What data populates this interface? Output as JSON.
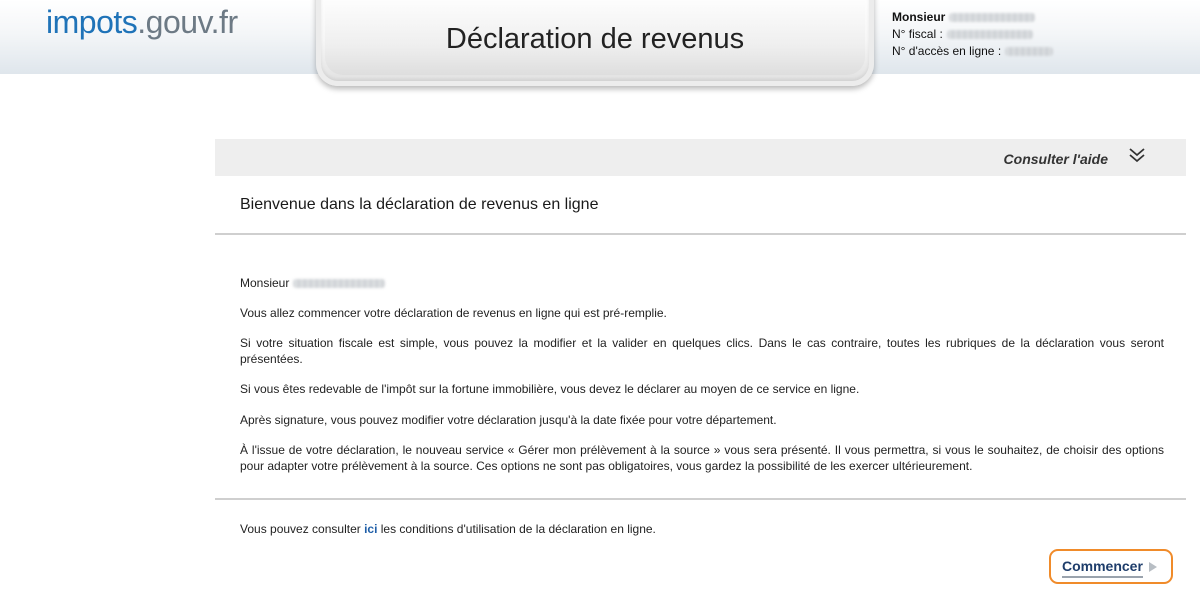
{
  "header": {
    "logo_part1": "impots",
    "logo_part2": ".gouv.fr",
    "page_title": "Déclaration de revenus",
    "user": {
      "salutation": "Monsieur",
      "fiscal_label": "N° fiscal :",
      "access_label": "N° d'accès en ligne :"
    }
  },
  "help": {
    "label": "Consulter l'aide",
    "icon": "double-chevron-down-icon"
  },
  "main": {
    "welcome": "Bienvenue dans la déclaration de revenus en ligne",
    "greeting": "Monsieur",
    "paragraphs": [
      "Vous allez commencer votre déclaration de revenus en ligne qui est pré-remplie.",
      "Si votre situation fiscale est simple, vous pouvez la modifier et la valider en quelques clics. Dans le cas contraire, toutes les rubriques de la déclaration vous seront présentées.",
      "Si vous êtes redevable de l'impôt sur la fortune immobilière, vous devez le déclarer au moyen de ce service en ligne.",
      "Après signature, vous pouvez modifier votre déclaration jusqu'à la date fixée pour votre département.",
      "À l'issue de votre déclaration, le nouveau service « Gérer mon prélèvement à la source » vous sera présenté. Il vous permettra, si vous le souhaitez, de choisir des options pour adapter votre prélèvement à la source. Ces options ne sont pas obligatoires, vous gardez la possibilité de les exercer ultérieurement."
    ]
  },
  "footer": {
    "text_before": "Vous pouvez consulter ",
    "link": "ici",
    "text_after": " les conditions d'utilisation de la déclaration en ligne."
  },
  "actions": {
    "start_label": "Commencer",
    "accent_color": "#f08b2a"
  }
}
